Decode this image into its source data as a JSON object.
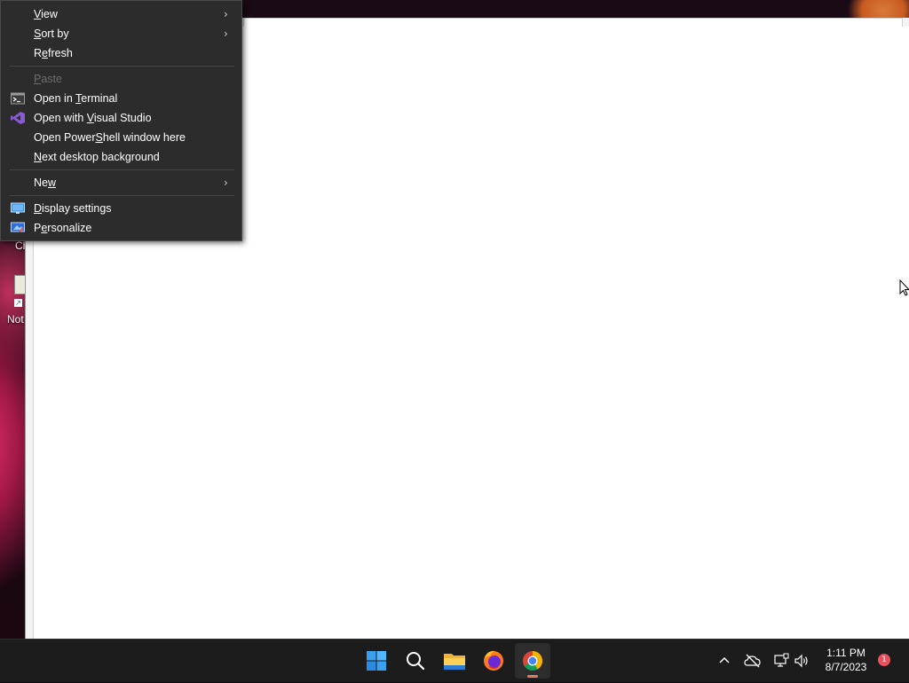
{
  "desktop": {
    "icon_labels": [
      "Ch",
      "Not"
    ]
  },
  "context_menu": {
    "items": [
      {
        "pre": "",
        "acc": "V",
        "post": "iew",
        "submenu": true
      },
      {
        "pre": "",
        "acc": "S",
        "post": "ort by",
        "submenu": true
      },
      {
        "pre": "R",
        "acc": "e",
        "post": "fresh"
      },
      {
        "pre": "",
        "acc": "P",
        "post": "aste",
        "disabled": true
      },
      {
        "pre": "Open in ",
        "acc": "T",
        "post": "erminal",
        "icon": "terminal-icon"
      },
      {
        "pre": "Open with ",
        "acc": "V",
        "post": "isual Studio",
        "icon": "visual-studio-icon"
      },
      {
        "pre": "Open Power",
        "acc": "S",
        "post": "hell window here"
      },
      {
        "pre": "",
        "acc": "N",
        "post": "ext desktop background"
      },
      {
        "pre": "Ne",
        "acc": "w",
        "post": "",
        "submenu": true
      },
      {
        "pre": "",
        "acc": "D",
        "post": "isplay settings",
        "icon": "display-settings-icon"
      },
      {
        "pre": "P",
        "acc": "e",
        "post": "rsonalize",
        "icon": "personalize-icon"
      }
    ]
  },
  "taskbar": {
    "apps": [
      "windows-start-icon",
      "search-icon",
      "file-explorer-icon",
      "firefox-icon",
      "chrome-icon"
    ],
    "active_app": "chrome-icon",
    "tray_icons": [
      "chevron-up-icon",
      "onedrive-offline-icon",
      "network-icon",
      "volume-icon"
    ],
    "time": "1:11 PM",
    "date": "8/7/2023",
    "notification_count": "1"
  },
  "colors": {
    "menu_bg": "#2c2c2c",
    "taskbar_bg": "#1c1c1c",
    "accent": "#e07c5b",
    "badge": "#e8505b"
  }
}
